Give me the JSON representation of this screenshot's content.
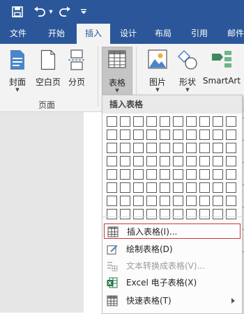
{
  "tabs": [
    "文件",
    "开始",
    "插入",
    "设计",
    "布局",
    "引用",
    "邮件"
  ],
  "ribbon": {
    "cover": "封面",
    "blank_page": "空白页",
    "page_break": "分页",
    "pages_group": "页面",
    "table": "表格",
    "picture": "图片",
    "shapes": "形状",
    "smartart": "SmartArt"
  },
  "menu": {
    "title": "插入表格",
    "items": [
      {
        "label": "插入表格(I)...",
        "icon": "table-icon",
        "disabled": false
      },
      {
        "label": "绘制表格(D)",
        "icon": "draw-table-icon",
        "disabled": false
      },
      {
        "label": "文本转换成表格(V)...",
        "icon": "convert-text-icon",
        "disabled": true
      },
      {
        "label": "Excel 电子表格(X)",
        "icon": "excel-icon",
        "disabled": false
      },
      {
        "label": "快速表格(T)",
        "icon": "quick-table-icon",
        "disabled": false
      }
    ]
  },
  "colors": {
    "accent": "#2b579a",
    "highlight_border": "#d13438",
    "ribbon_bg": "#f3f3f3"
  }
}
